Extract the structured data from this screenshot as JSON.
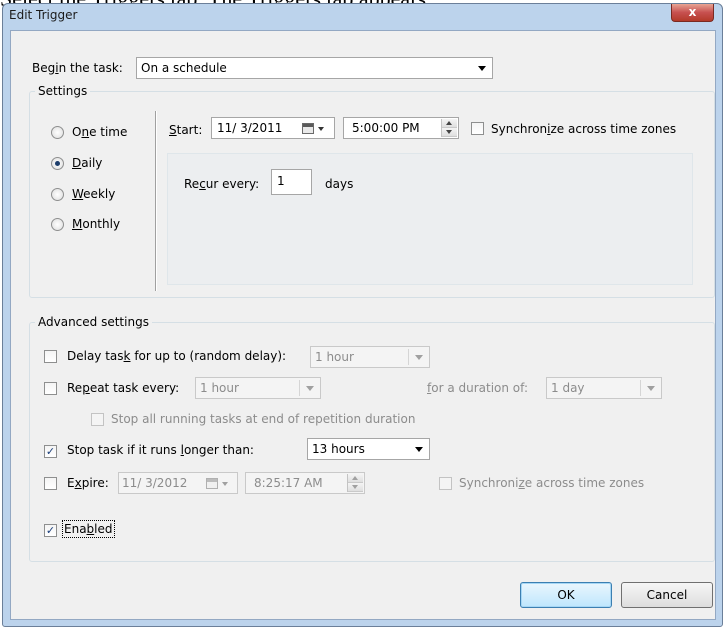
{
  "background_heading": "Select the Triggers tab. The Triggers tab appears.",
  "window": {
    "title": "Edit Trigger",
    "close_label": "x"
  },
  "begin": {
    "label_pre": "Beg",
    "label_u": "i",
    "label_post": "n the task:",
    "value": "On a schedule"
  },
  "settings": {
    "title": "Settings",
    "radios": [
      {
        "pre": "O",
        "u": "n",
        "post": "e time",
        "checked": false
      },
      {
        "pre": "",
        "u": "D",
        "post": "aily",
        "checked": true
      },
      {
        "pre": "",
        "u": "W",
        "post": "eekly",
        "checked": false
      },
      {
        "pre": "",
        "u": "M",
        "post": "onthly",
        "checked": false
      }
    ],
    "start_label_u": "S",
    "start_label_post": "tart:",
    "start_date": "11/ 3/2011",
    "start_time": "5:00:00 PM",
    "sync_pre": "Synchron",
    "sync_u": "i",
    "sync_post": "ze across time zones",
    "recur_pre": "Re",
    "recur_u": "c",
    "recur_post": "ur every:",
    "recur_value": "1",
    "recur_unit": "days"
  },
  "advanced": {
    "title": "Advanced settings",
    "delay_pre": "Delay tas",
    "delay_u": "k",
    "delay_post": " for up to (random delay):",
    "delay_value": "1 hour",
    "repeat_pre": "Re",
    "repeat_u": "p",
    "repeat_post": "eat task every:",
    "repeat_value": "1 hour",
    "duration_pre": "",
    "duration_u": "f",
    "duration_post": "or a duration of:",
    "duration_value": "1 day",
    "stop_all_label": "Stop all running tasks at end of repetition duration",
    "stop_pre": "Stop task if it runs ",
    "stop_u": "l",
    "stop_post": "onger than:",
    "stop_value": "13 hours",
    "expire_pre": "E",
    "expire_u": "x",
    "expire_post": "pire:",
    "expire_date": "11/ 3/2012",
    "expire_time": "8:25:17 AM",
    "expire_sync_pre": "Synchroni",
    "expire_sync_u": "z",
    "expire_sync_post": "e across time zones",
    "enabled_pre": "Ena",
    "enabled_u": "b",
    "enabled_post": "led"
  },
  "buttons": {
    "ok": "OK",
    "cancel": "Cancel"
  },
  "checks": {
    "mark": "✓"
  }
}
